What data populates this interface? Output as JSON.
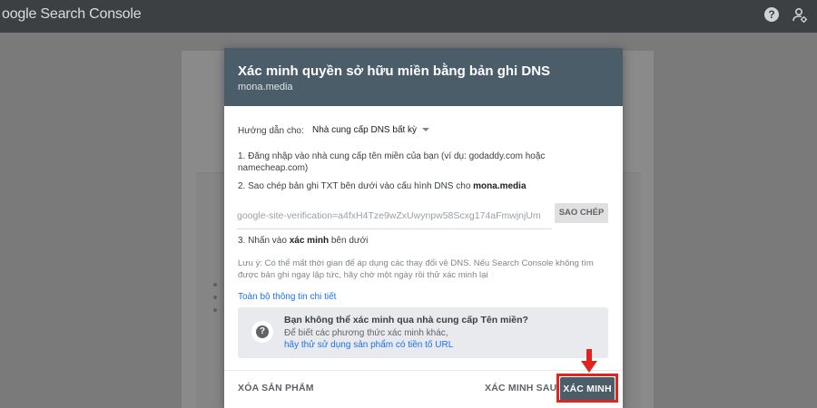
{
  "app": {
    "brand": "oogle Search Console",
    "help_icon": "help-icon",
    "account_icon": "account-settings-icon"
  },
  "dialog": {
    "title": "Xác minh quyền sở hữu miền bằng bản ghi DNS",
    "subtitle": "mona.media",
    "guide_label": "Hướng dẫn cho:",
    "guide_value": "Nhà cung cấp DNS bất kỳ",
    "step1": "1. Đăng nhập vào nhà cung cấp tên miền của bạn (ví dụ: godaddy.com hoặc namecheap.com)",
    "step2_prefix": "2. Sao chép bản ghi TXT bên dưới vào cấu hình DNS cho ",
    "step2_domain": "mona.media",
    "txt_record": "google-site-verification=a4fxH4Tze9wZxUwynpw58Scxg174aFmwjnjUm",
    "copy_label": "SAO CHÉP",
    "step3_prefix": "3. Nhấn vào ",
    "step3_bold": "xác minh",
    "step3_suffix": " bên dưới",
    "note": "Lưu ý: Có thể mất thời gian để áp dụng các thay đổi về DNS. Nếu Search Console không tìm được bản ghi ngay lập tức, hãy chờ một ngày rồi thử xác minh lại",
    "details_link": "Toàn bộ thông tin chi tiết",
    "info": {
      "title": "Bạn không thể xác minh qua nhà cung cấp Tên miền?",
      "line": "Để biết các phương thức xác minh khác,",
      "link": "hãy thử sử dụng sản phẩm có tiền tố URL"
    },
    "remove_label": "XÓA SẢN PHẨM",
    "later_label": "XÁC MINH SAU",
    "verify_label": "XÁC MINH"
  },
  "colors": {
    "header": "#4b5d69",
    "link": "#1a73e8",
    "annotation": "#e0241f"
  }
}
